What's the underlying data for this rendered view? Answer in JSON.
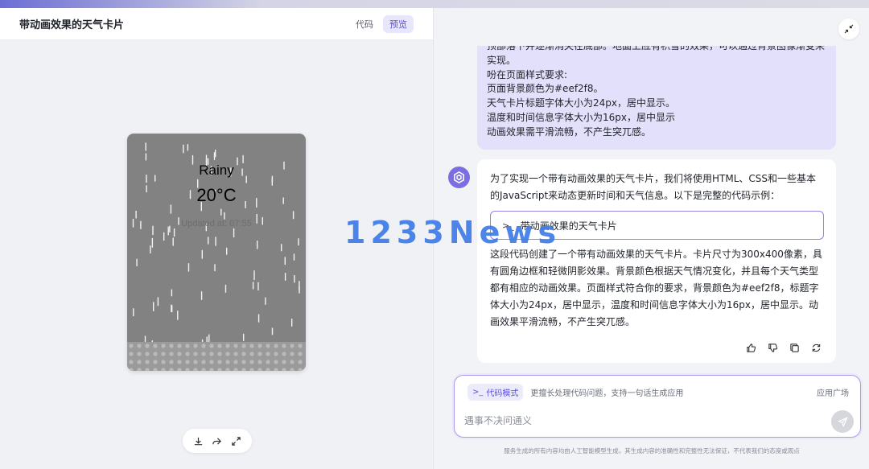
{
  "left": {
    "title": "带动画效果的天气卡片",
    "tabs": [
      {
        "label": "代码",
        "active": false
      },
      {
        "label": "预览",
        "active": true
      }
    ]
  },
  "weather": {
    "condition": "Rainy",
    "temperature": "20°C",
    "updated": "Updated at: 07:55"
  },
  "preview_tools": [
    "download-icon",
    "share-icon",
    "fullscreen-icon"
  ],
  "user_message": {
    "lines": [
      "顶部落下并逐渐消失在底部。地面上应有积雪的效果，可以通过背景图像渐变来",
      "实现。",
      "吩在页面样式要求:",
      "页面背景颜色为#eef2f8。",
      "天气卡片标题字体大小为24px，居中显示。",
      "温度和时间信息字体大小为16px，居中显示",
      "动画效果需平滑流畅，不产生突兀感。"
    ]
  },
  "bot_message": {
    "intro": "为了实现一个带有动画效果的天气卡片，我们将使用HTML、CSS和一些基本的JavaScript来动态更新时间和天气信息。以下是完整的代码示例：",
    "code_block_label": "带动画效果的天气卡片",
    "summary": "这段代码创建了一个带有动画效果的天气卡片。卡片尺寸为300x400像素，具有圆角边框和轻微阴影效果。背景颜色根据天气情况变化，并且每个天气类型都有相应的动画效果。页面样式符合你的要求，背景颜色为#eef2f8，标题字体大小为24px，居中显示，温度和时间信息字体大小为16px，居中显示。动画效果平滑流畅，不产生突兀感。",
    "actions": [
      "thumbs-up-icon",
      "thumbs-down-icon",
      "copy-icon",
      "regenerate-icon"
    ]
  },
  "input": {
    "mode_label": "代码模式",
    "mode_description": "更擅长处理代码问题，支持一句话生成应用",
    "app_square": "应用广场",
    "placeholder": "遇事不决问通义"
  },
  "disclaimer": "服务生成的所有内容均由人工智能模型生成，其生成内容的准确性和完整性无法保证，不代表我们的态度或观点",
  "watermark": "1233News",
  "colors": {
    "accent": "#5b4fd8",
    "user_bubble": "#e2e0fb",
    "card_bg": "#828282"
  }
}
